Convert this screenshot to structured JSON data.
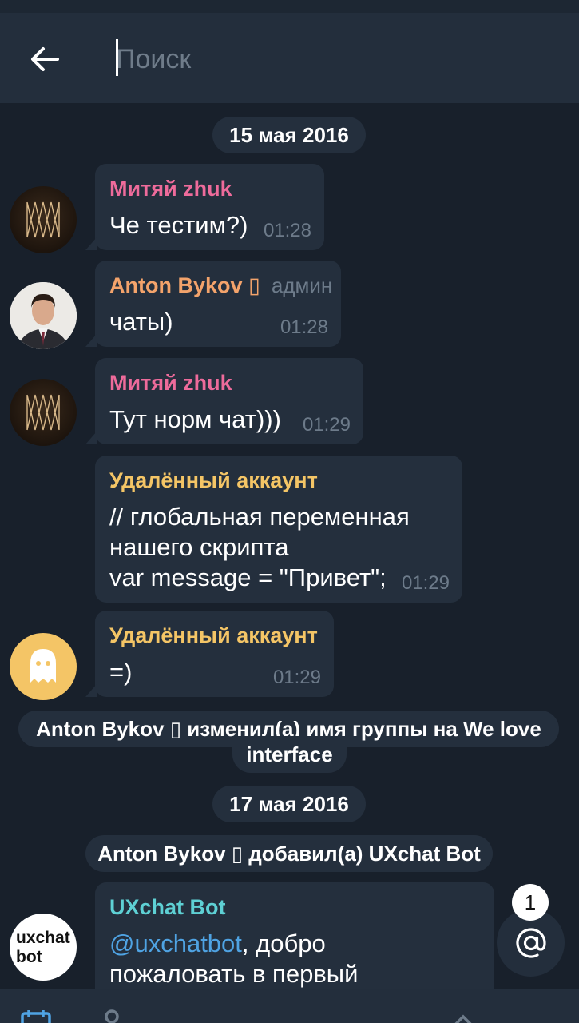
{
  "header": {
    "search_placeholder": "Поиск"
  },
  "dates": [
    "15 мая 2016",
    "17 мая 2016"
  ],
  "messages": [
    {
      "sender": "Митяй zhuk",
      "sender_color": "#ee6b9b",
      "text": "Че тестим?)",
      "time": "01:28",
      "avatar": "pattern-avatar"
    },
    {
      "sender": "Anton Bykov ▯",
      "sender_color": "#f3a36b",
      "role": "админ",
      "text": "чаты)",
      "time": "01:28",
      "avatar": "photo-avatar"
    },
    {
      "sender": "Митяй zhuk",
      "sender_color": "#ee6b9b",
      "text": "Тут норм чат)))",
      "time": "01:29",
      "avatar": "pattern-avatar"
    },
    {
      "sender": "Удалённый аккаунт",
      "sender_color": "#f4c566",
      "lines": [
        "// глобальная переменная",
        "нашего скрипта",
        "var message = \"Привет\";"
      ],
      "time": "01:29"
    },
    {
      "sender": "Удалённый аккаунт",
      "sender_color": "#f4c566",
      "text": "=)",
      "time": "01:29",
      "avatar": "ghost-avatar"
    },
    {
      "sender": "UXchat Bot",
      "sender_color": "#5ed0d4",
      "mention": "@uxchatbot",
      "line1_rest": ", добро",
      "line2": "пожаловать в первый",
      "avatar_lines": [
        "uxchat",
        "bot"
      ]
    }
  ],
  "service": {
    "rename_line1": "Anton Bykov ▯ изменил(а) имя группы на We love",
    "rename_line2": "interface",
    "added": "Anton Bykov ▯ добавил(а) UXchat Bot"
  },
  "mention_badge": {
    "count": "1",
    "icon": "at-sign-icon"
  },
  "colors": {
    "background": "#18202b",
    "header": "#232e3c",
    "bubble": "#242f3d",
    "time": "#6d7b8a",
    "link": "#4fa3e3"
  }
}
